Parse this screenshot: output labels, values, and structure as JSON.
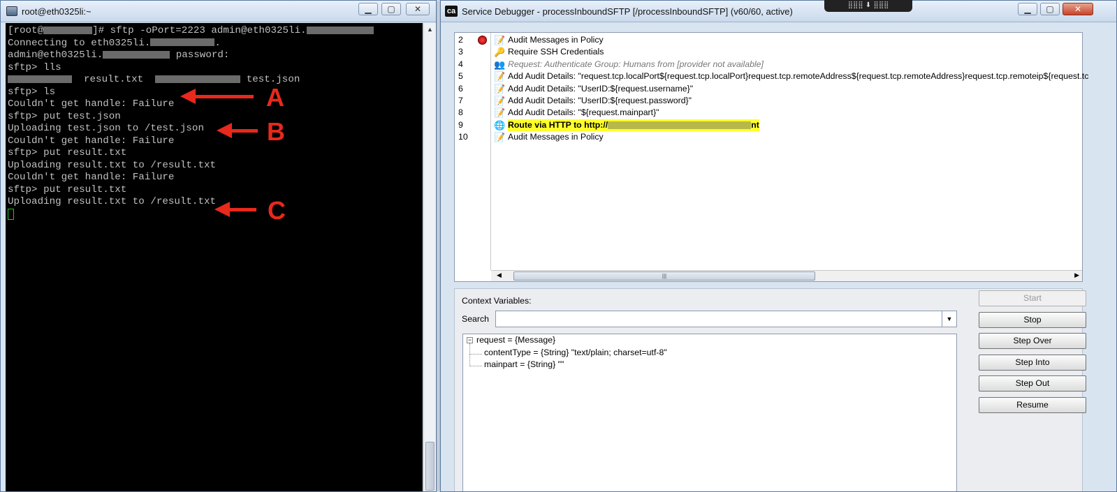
{
  "terminal": {
    "title": "root@eth0325li:~",
    "lines": [
      {
        "parts": [
          {
            "t": "[root@"
          },
          {
            "r": 70
          },
          {
            "t": "]# sftp -oPort=2223 admin@eth0325li."
          },
          {
            "r": 96
          }
        ]
      },
      {
        "parts": [
          {
            "t": "Connecting to eth0325li."
          },
          {
            "r": 92
          },
          {
            "t": "."
          }
        ]
      },
      {
        "parts": [
          {
            "t": "admin@eth0325li."
          },
          {
            "r": 96
          },
          {
            "t": " password:"
          }
        ]
      },
      {
        "parts": [
          {
            "t": "sftp> lls"
          }
        ]
      },
      {
        "parts": [
          {
            "r": 92
          },
          {
            "t": "  result.txt  "
          },
          {
            "r": 122
          },
          {
            "t": " test.json"
          }
        ]
      },
      {
        "parts": [
          {
            "t": "sftp> ls"
          }
        ]
      },
      {
        "parts": [
          {
            "t": "Couldn't get handle: Failure"
          }
        ]
      },
      {
        "parts": [
          {
            "t": "sftp> put test.json"
          }
        ]
      },
      {
        "parts": [
          {
            "t": "Uploading test.json to /test.json"
          }
        ]
      },
      {
        "parts": [
          {
            "t": "Couldn't get handle: Failure"
          }
        ]
      },
      {
        "parts": [
          {
            "t": "sftp> put result.txt"
          }
        ]
      },
      {
        "parts": [
          {
            "t": "Uploading result.txt to /result.txt"
          }
        ]
      },
      {
        "parts": [
          {
            "t": "Couldn't get handle: Failure"
          }
        ]
      },
      {
        "parts": [
          {
            "t": "sftp> put result.txt"
          }
        ]
      },
      {
        "parts": [
          {
            "t": "Uploading result.txt to /result.txt"
          }
        ]
      }
    ],
    "annotations": [
      "A",
      "B",
      "C"
    ],
    "annotation_color": "#e8291c"
  },
  "debugger": {
    "title": "Service Debugger - processInboundSFTP [/processInboundSFTP] (v60/60, active)",
    "logo": "ca",
    "assertions": [
      {
        "num": "2",
        "icon": "📝",
        "text": "Audit Messages in Policy",
        "breakpoint": true,
        "style": ""
      },
      {
        "num": "3",
        "icon": "🔑",
        "text": "Require SSH Credentials",
        "style": ""
      },
      {
        "num": "4",
        "icon": "👥",
        "text": "Request: Authenticate Group: Humans from [provider not available]",
        "style": "gray"
      },
      {
        "num": "5",
        "icon": "📝",
        "text": "Add Audit Details: \"request.tcp.localPort${request.tcp.localPort}request.tcp.remoteAddress${request.tcp.remoteAddress}request.tcp.remoteip${request.tc",
        "style": ""
      },
      {
        "num": "6",
        "icon": "📝",
        "text": "Add Audit Details: \"UserID:${request.username}\"",
        "style": ""
      },
      {
        "num": "7",
        "icon": "📝",
        "text": "Add Audit Details: \"UserID:${request.password}\"",
        "style": ""
      },
      {
        "num": "8",
        "icon": "📝",
        "text": "Add Audit Details: \"${request.mainpart}\"",
        "style": ""
      },
      {
        "num": "9",
        "icon": "🌐",
        "text": "Route via HTTP to http://",
        "text_end": "nt",
        "style": "hl"
      },
      {
        "num": "10",
        "icon": "📝",
        "text": "Audit Messages in Policy",
        "style": ""
      }
    ],
    "context_label": "Context Variables:",
    "search_label": "Search",
    "tree": {
      "root": "request = {Message}",
      "children": [
        "contentType = {String} \"text/plain; charset=utf-8\"",
        "mainpart = {String} \"\""
      ]
    },
    "buttons": [
      {
        "label": "Start",
        "enabled": false
      },
      {
        "label": "Stop",
        "enabled": true
      },
      {
        "label": "Step Over",
        "enabled": true
      },
      {
        "label": "Step Into",
        "enabled": true
      },
      {
        "label": "Step Out",
        "enabled": true
      },
      {
        "label": "Resume",
        "enabled": true
      }
    ]
  }
}
